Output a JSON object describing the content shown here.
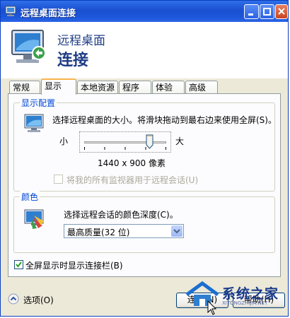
{
  "window": {
    "title": "远程桌面连接"
  },
  "header": {
    "line1": "远程桌面",
    "line2": "连接"
  },
  "tabs": [
    {
      "label": "常规",
      "active": false
    },
    {
      "label": "显示",
      "active": true
    },
    {
      "label": "本地资源",
      "active": false
    },
    {
      "label": "程序",
      "active": false
    },
    {
      "label": "体验",
      "active": false
    },
    {
      "label": "高级",
      "active": false
    }
  ],
  "display_config": {
    "legend": "显示配置",
    "description": "选择远程桌面的大小。将滑块拖动到最右边来使用全屏(S)。",
    "small_label": "小",
    "large_label": "大",
    "resolution": "1440 x 900 像素",
    "slider_fraction": 0.8,
    "multi_monitor_label": "将我的所有监视器用于远程会话(U)",
    "multi_monitor_checked": false,
    "multi_monitor_enabled": false
  },
  "colors": {
    "legend": "颜色",
    "description": "选择远程会话的颜色深度(C)。",
    "selected": "最高质量(32 位)"
  },
  "fullscreen_bar": {
    "label": "全屏显示时显示连接栏(B)",
    "checked": true
  },
  "footer": {
    "options_label": "选项(O)",
    "connect_label": "连接(N)",
    "help_label": "帮助(H)"
  },
  "watermark": {
    "text": "系统之家",
    "sub": "XITONGZHIJIA.NET"
  },
  "accent_colors": {
    "title_bar": "#1a4fd1",
    "group_legend": "#0046d5",
    "tab_highlight": "#f8b34a"
  }
}
